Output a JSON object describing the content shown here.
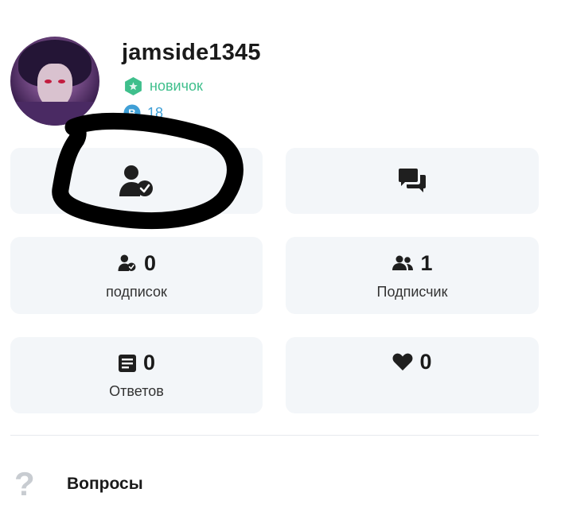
{
  "profile": {
    "username": "jamside1345",
    "rank": "новичок",
    "points": "18"
  },
  "buttons": {
    "follow_icon": "user-check-icon",
    "message_icon": "chat-bubbles-icon"
  },
  "stats": {
    "following": {
      "value": "0",
      "label": "подписок",
      "icon": "user-check-icon"
    },
    "followers": {
      "value": "1",
      "label": "Подписчик",
      "icon": "users-icon"
    },
    "answers": {
      "value": "0",
      "label": "Ответов",
      "icon": "document-list-icon"
    },
    "likes": {
      "value": "0",
      "icon": "heart-icon"
    }
  },
  "sections": {
    "questions_label": "Вопросы",
    "questions_icon": "?"
  },
  "colors": {
    "rank": "#3fbf8c",
    "points": "#3f9fd6",
    "card_bg": "#f3f6f9",
    "annotation": "#000000"
  }
}
